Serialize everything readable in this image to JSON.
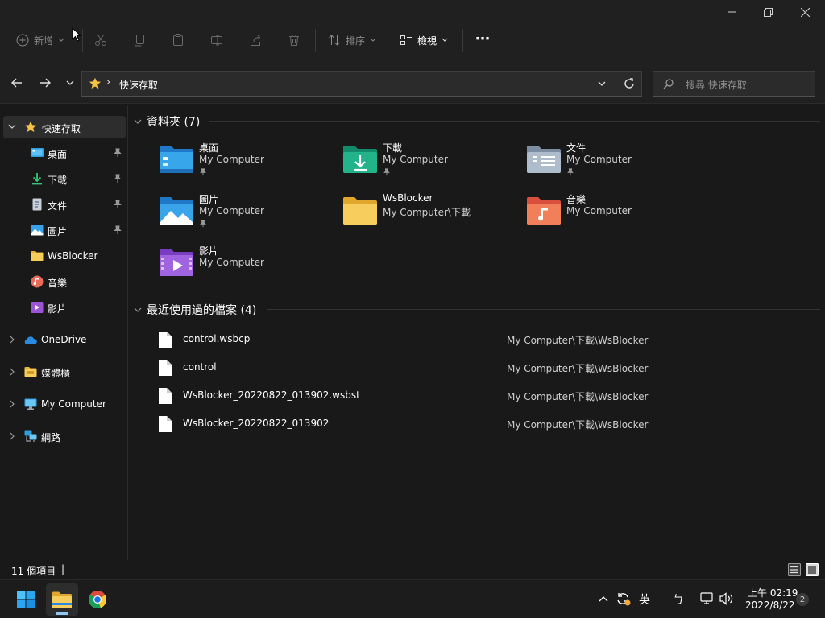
{
  "window": {
    "minimize_label": "—",
    "maximize_label": "❐",
    "close_label": "✕"
  },
  "toolbar": {
    "new_label": "新增",
    "sort_label": "排序",
    "view_label": "檢視",
    "more_label": "⋯"
  },
  "address": {
    "location": "快速存取",
    "separator": "›",
    "search_placeholder": "搜尋 快速存取"
  },
  "sidebar": {
    "quick_access": "快速存取",
    "items": [
      {
        "label": "桌面",
        "pinned": true
      },
      {
        "label": "下載",
        "pinned": true
      },
      {
        "label": "文件",
        "pinned": true
      },
      {
        "label": "圖片",
        "pinned": true
      },
      {
        "label": "WsBlocker",
        "pinned": false
      },
      {
        "label": "音樂",
        "pinned": false
      },
      {
        "label": "影片",
        "pinned": false
      }
    ],
    "roots": [
      {
        "label": "OneDrive"
      },
      {
        "label": "媒體櫃"
      },
      {
        "label": "My Computer"
      },
      {
        "label": "網路"
      }
    ]
  },
  "folders": {
    "heading": "資料夾 (7)",
    "items": [
      {
        "name": "桌面",
        "path": "My Computer",
        "pinned": true,
        "icon": "desktop-folder-icon"
      },
      {
        "name": "下載",
        "path": "My Computer",
        "pinned": true,
        "icon": "downloads-folder-icon"
      },
      {
        "name": "文件",
        "path": "My Computer",
        "pinned": true,
        "icon": "documents-folder-icon"
      },
      {
        "name": "圖片",
        "path": "My Computer",
        "pinned": true,
        "icon": "pictures-folder-icon"
      },
      {
        "name": "WsBlocker",
        "path": "My Computer\\下載",
        "pinned": false,
        "icon": "folder-icon"
      },
      {
        "name": "音樂",
        "path": "My Computer",
        "pinned": false,
        "icon": "music-folder-icon"
      },
      {
        "name": "影片",
        "path": "My Computer",
        "pinned": false,
        "icon": "videos-folder-icon"
      }
    ]
  },
  "recent": {
    "heading": "最近使用過的檔案 (4)",
    "items": [
      {
        "name": "control.wsbcp",
        "path": "My Computer\\下載\\WsBlocker"
      },
      {
        "name": "control",
        "path": "My Computer\\下載\\WsBlocker"
      },
      {
        "name": "WsBlocker_20220822_013902.wsbst",
        "path": "My Computer\\下載\\WsBlocker"
      },
      {
        "name": "WsBlocker_20220822_013902",
        "path": "My Computer\\下載\\WsBlocker"
      }
    ]
  },
  "status": {
    "count": "11 個項目",
    "cursor": "|"
  },
  "taskbar": {
    "ime_label": "英",
    "ime_mode": "ㄅ",
    "time": "上午 02:19",
    "date": "2022/8/22",
    "notifications": "2"
  },
  "colors": {
    "accent": "#0078d4",
    "folder_yellow": "#f5c84c",
    "background": "#191919"
  }
}
